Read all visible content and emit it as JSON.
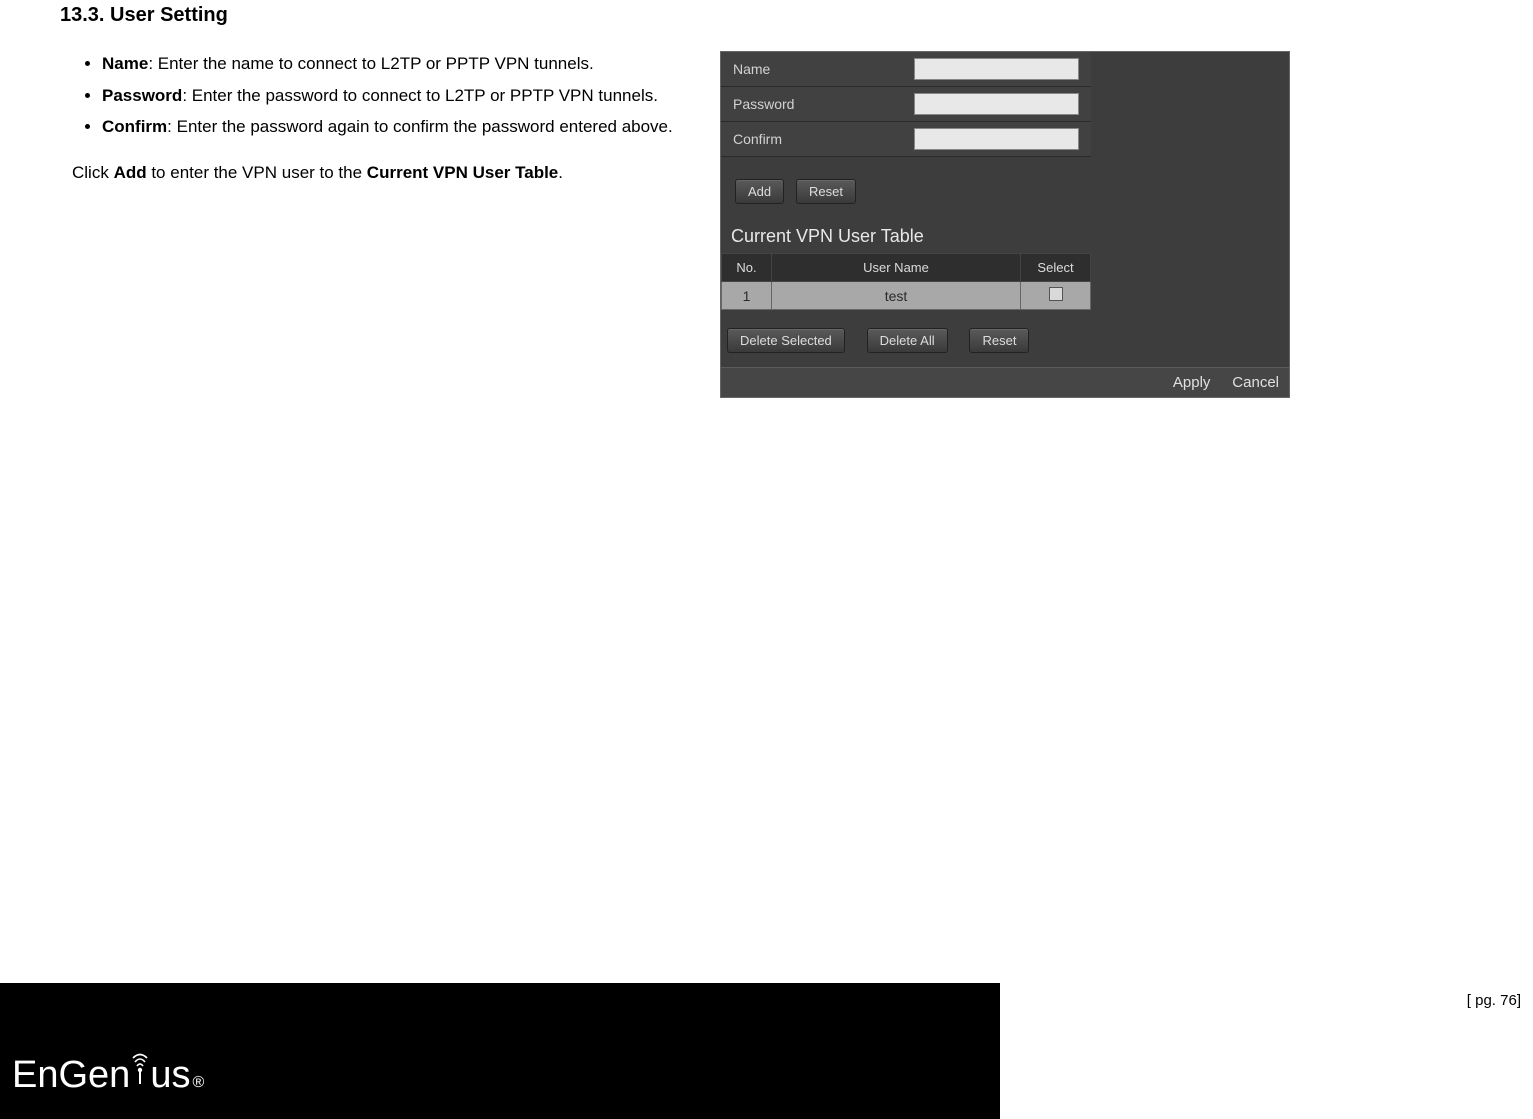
{
  "doc": {
    "section_heading": "13.3.  User Setting",
    "bullets": [
      {
        "term": "Name",
        "desc": ": Enter the name to connect to L2TP or PPTP VPN tunnels."
      },
      {
        "term": "Password",
        "desc": ": Enter the password to connect to L2TP or PPTP VPN tunnels."
      },
      {
        "term": "Confirm",
        "desc": ": Enter the password again to confirm the password entered above."
      }
    ],
    "instruction_prefix": "Click ",
    "instruction_bold1": "Add",
    "instruction_mid": " to enter the VPN user to the ",
    "instruction_bold2": "Current VPN User Table",
    "instruction_suffix": "."
  },
  "panel": {
    "fields": {
      "name_label": "Name",
      "password_label": "Password",
      "confirm_label": "Confirm"
    },
    "buttons": {
      "add": "Add",
      "reset_top": "Reset",
      "delete_selected": "Delete Selected",
      "delete_all": "Delete All",
      "reset_bottom": "Reset",
      "apply": "Apply",
      "cancel": "Cancel"
    },
    "table": {
      "title": "Current VPN User Table",
      "headers": {
        "no": "No.",
        "user_name": "User Name",
        "select": "Select"
      },
      "rows": [
        {
          "no": "1",
          "user_name": "test"
        }
      ]
    }
  },
  "footer": {
    "logo_text_1": "EnGen",
    "logo_text_2": "us",
    "page_label": "[ pg. 76]"
  }
}
